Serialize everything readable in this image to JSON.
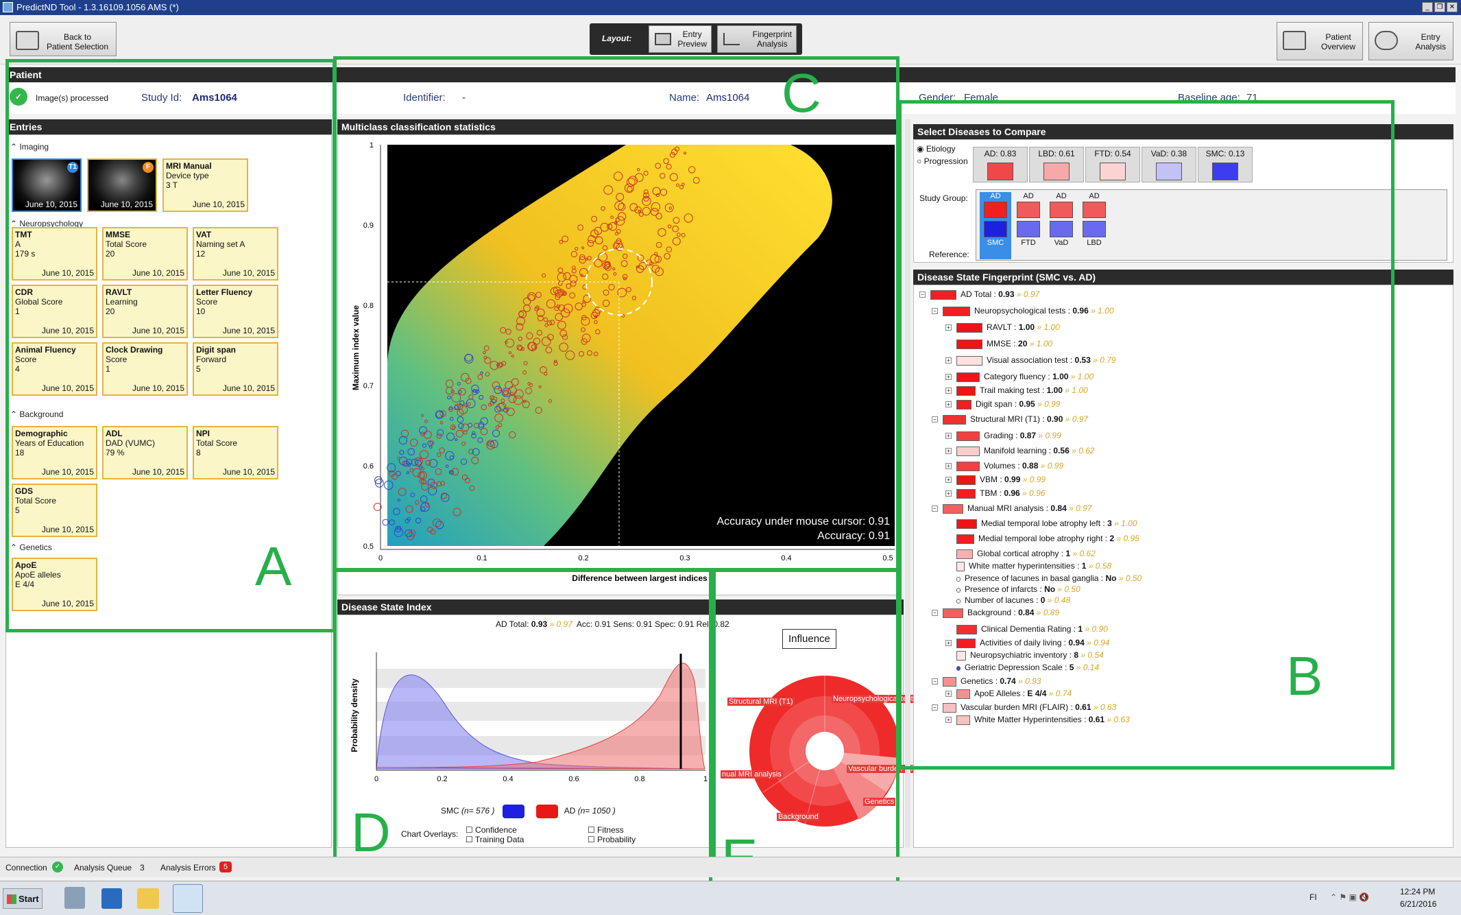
{
  "window": {
    "title": "PredictND Tool - 1.3.16109.1056 AMS (*)"
  },
  "toolbar": {
    "back_label": "Back to\nPatient Selection",
    "layout_label": "Layout:",
    "entry_preview": "Entry\nPreview",
    "fingerprint_analysis": "Fingerprint\nAnalysis",
    "patient_overview": "Patient\nOverview",
    "entry_analysis": "Entry\nAnalysis"
  },
  "patient": {
    "header": "Patient",
    "status": "Image(s) processed",
    "study_id_label": "Study Id:",
    "study_id": "Ams1064",
    "identifier_label": "Identifier:",
    "identifier": "-",
    "name_label": "Name:",
    "name": "Ams1064",
    "gender_label": "Gender:",
    "gender": "Female",
    "baseline_age_label": "Baseline age:",
    "baseline_age": "71"
  },
  "entries": {
    "header": "Entries",
    "imaging_label": "Imaging",
    "thumb1_date": "June 10, 2015",
    "thumb1_badge": "T1",
    "thumb2_date": "June 10, 2015",
    "thumb2_badge": "F",
    "mri_manual": {
      "title": "MRI Manual",
      "l1": "Device type",
      "l2": "3 T",
      "date": "June 10, 2015"
    },
    "neuro_label": "Neuropsychology",
    "background_label": "Background",
    "genetics_label": "Genetics",
    "cards": [
      {
        "title": "TMT",
        "l1": "A",
        "l2": "179 s",
        "date": "June 10, 2015"
      },
      {
        "title": "MMSE",
        "l1": "Total Score",
        "l2": "20",
        "date": "June 10, 2015"
      },
      {
        "title": "VAT",
        "l1": "Naming set A",
        "l2": "12",
        "date": "June 10, 2015"
      },
      {
        "title": "CDR",
        "l1": "Global Score",
        "l2": "1",
        "date": "June 10, 2015"
      },
      {
        "title": "RAVLT",
        "l1": "Learning",
        "l2": "20",
        "date": "June 10, 2015"
      },
      {
        "title": "Letter Fluency",
        "l1": "Score",
        "l2": "10",
        "date": "June 10, 2015"
      },
      {
        "title": "Animal Fluency",
        "l1": "Score",
        "l2": "4",
        "date": "June 10, 2015"
      },
      {
        "title": "Clock Drawing",
        "l1": "Score",
        "l2": "1",
        "date": "June 10, 2015"
      },
      {
        "title": "Digit span",
        "l1": "Forward",
        "l2": "5",
        "date": "June 10, 2015"
      },
      {
        "title": "Demographic",
        "l1": "Years of Education",
        "l2": "18",
        "date": "June 10, 2015"
      },
      {
        "title": "ADL",
        "l1": "DAD (VUMC)",
        "l2": "79 %",
        "date": "June 10, 2015"
      },
      {
        "title": "NPI",
        "l1": "Total Score",
        "l2": "8",
        "date": "June 10, 2015"
      },
      {
        "title": "GDS",
        "l1": "Total Score",
        "l2": "5",
        "date": "June 10, 2015"
      },
      {
        "title": "ApoE",
        "l1": "ApoE alleles",
        "l2": "E 4/4",
        "date": "June 10, 2015"
      }
    ]
  },
  "multiclass": {
    "header": "Multiclass classification statistics",
    "ylabel": "Maximum index value",
    "xlabel": "Difference between largest indices",
    "acc_cursor": "Accuracy under mouse cursor: 0.91",
    "acc": "Accuracy: 0.91",
    "yticks": [
      "1",
      "0.9",
      "0.8",
      "0.7",
      "0.6",
      "0.5"
    ],
    "xticks": [
      "0",
      "0.1",
      "0.2",
      "0.3",
      "0.4",
      "0.5"
    ]
  },
  "dsi": {
    "header": "Disease State Index",
    "stats_prefix": "AD Total:",
    "stats_value": "0.93",
    "stats_ref": "» 0.97",
    "stats_rest": "Acc: 0.91   Sens: 0.91   Spec: 0.91   Rel: 0.82",
    "ylabel": "Probability density",
    "xticks": [
      "0",
      "0.2",
      "0.4",
      "0.6",
      "0.8",
      "1"
    ],
    "smc_label": "SMC",
    "smc_n": "(n= 576 )",
    "ad_label": "AD",
    "ad_n": "(n= 1050 )",
    "overlays_label": "Chart Overlays:",
    "opt_confidence": "Confidence",
    "opt_training": "Training Data",
    "opt_fitness": "Fitness",
    "opt_probability": "Probability"
  },
  "influence": {
    "title": "Influence",
    "labels": [
      "Structural MRI (T1)",
      "Neuropsychological test",
      "Vascular burden MR",
      "Genetics",
      "Background",
      "nual MRI analysis"
    ]
  },
  "compare": {
    "header": "Select Diseases to Compare",
    "etiology": "Etiology",
    "progression": "Progression",
    "diseases": [
      {
        "label": "AD: 0.83",
        "color": "#f04848"
      },
      {
        "label": "LBD: 0.61",
        "color": "#f7a9a9"
      },
      {
        "label": "FTD: 0.54",
        "color": "#fbd3d3"
      },
      {
        "label": "VaD: 0.38",
        "color": "#c2c2f8"
      },
      {
        "label": "SMC: 0.13",
        "color": "#3d3df0"
      }
    ],
    "study_group_label": "Study Group:",
    "reference_label": "Reference:",
    "groups": [
      {
        "top": "AD",
        "bottom": "SMC"
      },
      {
        "top": "AD",
        "bottom": "FTD"
      },
      {
        "top": "AD",
        "bottom": "VaD"
      },
      {
        "top": "AD",
        "bottom": "LBD"
      }
    ]
  },
  "fingerprint": {
    "header": "Disease State Fingerprint (SMC vs. AD)",
    "rows": [
      {
        "text": "AD Total :",
        "val": "0.93",
        "ref": "» 0.97",
        "lvl": 0,
        "color": "#ee2020",
        "w": 38
      },
      {
        "text": "Neuropsychological tests :",
        "val": "0.96",
        "ref": "» 1.00",
        "lvl": 1,
        "color": "#ee2020",
        "w": 40
      },
      {
        "text": "RAVLT :",
        "val": "1.00",
        "ref": "» 1.00",
        "lvl": 2,
        "color": "#ee1515",
        "w": 38
      },
      {
        "text": "MMSE :",
        "val": "20",
        "ref": "» 1.00",
        "lvl": 2,
        "color": "#ee1515",
        "w": 38
      },
      {
        "text": "Visual association test :",
        "val": "0.53",
        "ref": "» 0.79",
        "lvl": 2,
        "color": "#fde0e0",
        "w": 38
      },
      {
        "text": "Category fluency :",
        "val": "1.00",
        "ref": "» 1.00",
        "lvl": 2,
        "color": "#ee1515",
        "w": 34
      },
      {
        "text": "Trail making test :",
        "val": "1.00",
        "ref": "» 1.00",
        "lvl": 2,
        "color": "#ee1515",
        "w": 28
      },
      {
        "text": "Digit span :",
        "val": "0.95",
        "ref": "» 0.99",
        "lvl": 2,
        "color": "#ee2020",
        "w": 22
      },
      {
        "text": "Structural MRI (T1) :",
        "val": "0.90",
        "ref": "» 0.97",
        "lvl": 1,
        "color": "#ee3030",
        "w": 34
      },
      {
        "text": "Grading :",
        "val": "0.87",
        "ref": "» 0.99",
        "lvl": 2,
        "color": "#f04040",
        "w": 34
      },
      {
        "text": "Manifold learning :",
        "val": "0.56",
        "ref": "» 0.62",
        "lvl": 2,
        "color": "#fbcccc",
        "w": 34
      },
      {
        "text": "Volumes :",
        "val": "0.88",
        "ref": "» 0.99",
        "lvl": 2,
        "color": "#f04040",
        "w": 34
      },
      {
        "text": "VBM :",
        "val": "0.99",
        "ref": "» 0.99",
        "lvl": 2,
        "color": "#ee1515",
        "w": 28
      },
      {
        "text": "TBM :",
        "val": "0.96",
        "ref": "» 0.96",
        "lvl": 2,
        "color": "#ee2020",
        "w": 28
      },
      {
        "text": "Manual MRI analysis :",
        "val": "0.84",
        "ref": "» 0.97",
        "lvl": 1,
        "color": "#f06060",
        "w": 30
      },
      {
        "text": "Medial temporal lobe atrophy left :",
        "val": "3",
        "ref": "» 1.00",
        "lvl": 2,
        "color": "#ee1515",
        "w": 30
      },
      {
        "text": "Medial temporal lobe atrophy right :",
        "val": "2",
        "ref": "» 0.95",
        "lvl": 2,
        "color": "#ee2020",
        "w": 26
      },
      {
        "text": "Global cortical atrophy :",
        "val": "1",
        "ref": "» 0.62",
        "lvl": 2,
        "color": "#f7b0b0",
        "w": 24
      },
      {
        "text": "White matter hyperintensities :",
        "val": "1",
        "ref": "» 0.58",
        "lvl": 2,
        "color": "#fde6e6",
        "w": 12
      },
      {
        "text": "Presence of lacunes in basal ganglia :",
        "val": "No",
        "ref": "» 0.50",
        "lvl": 2,
        "color": "#ffffff",
        "w": 6
      },
      {
        "text": "Presence of infarcts :",
        "val": "No",
        "ref": "» 0.50",
        "lvl": 2,
        "color": "#ffffff",
        "w": 6
      },
      {
        "text": "Number of lacunes :",
        "val": "0",
        "ref": "» 0.48",
        "lvl": 2,
        "color": "#ffffff",
        "w": 6
      },
      {
        "text": "Background :",
        "val": "0.84",
        "ref": "» 0.89",
        "lvl": 1,
        "color": "#f06060",
        "w": 30
      },
      {
        "text": "Clinical Dementia Rating :",
        "val": "1",
        "ref": "» 0.90",
        "lvl": 2,
        "color": "#ee3030",
        "w": 30
      },
      {
        "text": "Activities of daily living :",
        "val": "0.94",
        "ref": "» 0.94",
        "lvl": 2,
        "color": "#ee2020",
        "w": 28
      },
      {
        "text": "Neuropsychiatric inventory :",
        "val": "8",
        "ref": "» 0.54",
        "lvl": 2,
        "color": "#fde6e6",
        "w": 14
      },
      {
        "text": "Geriatric Depression Scale :",
        "val": "5",
        "ref": "» 0.14",
        "lvl": 2,
        "color": "#4444dd",
        "w": 6
      },
      {
        "text": "Genetics :",
        "val": "0.74",
        "ref": "» 0.93",
        "lvl": 1,
        "color": "#f49090",
        "w": 20
      },
      {
        "text": "ApoE Alleles :",
        "val": "E 4/4",
        "ref": "» 0.74",
        "lvl": 2,
        "color": "#f49090",
        "w": 20
      },
      {
        "text": "Vascular burden MRI (FLAIR) :",
        "val": "0.61",
        "ref": "» 0.63",
        "lvl": 1,
        "color": "#f8c0c0",
        "w": 20
      },
      {
        "text": "White Matter Hyperintensities :",
        "val": "0.61",
        "ref": "» 0.63",
        "lvl": 2,
        "color": "#f8c0c0",
        "w": 20
      }
    ]
  },
  "annotations": {
    "A": "A",
    "B": "B",
    "C": "C",
    "D": "D",
    "E": "E"
  },
  "statusbar": {
    "connection": "Connection",
    "queue": "Analysis Queue",
    "queue_count": "3",
    "errors": "Analysis Errors",
    "errors_count": "5"
  },
  "taskbar": {
    "start": "Start",
    "lang": "FI",
    "time": "12:24 PM",
    "date": "6/21/2016"
  },
  "colors": {
    "accent_green": "#27b04a",
    "smc_blue": "#1f1fe0",
    "ad_red": "#e81818",
    "entry_border": "#e2b53a"
  }
}
